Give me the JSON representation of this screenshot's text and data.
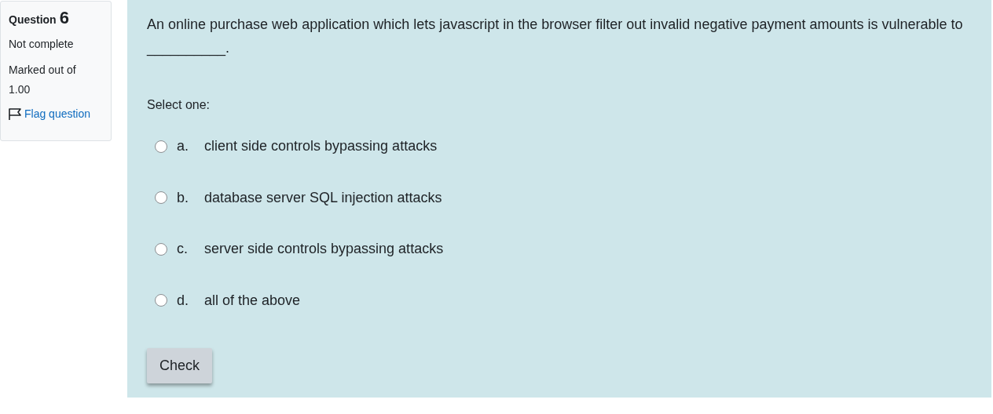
{
  "info": {
    "label": "Question",
    "number": "6",
    "status": "Not complete",
    "mark": "Marked out of 1.00",
    "flag": {
      "label": "Flag question",
      "flagged": false
    }
  },
  "question": {
    "text": "An online purchase web application which lets javascript in the browser filter out invalid negative payment amounts is vulnerable to __________.",
    "prompt": "Select one:",
    "options": [
      {
        "letter": "a.",
        "text": "client side controls bypassing attacks",
        "selected": false
      },
      {
        "letter": "b.",
        "text": "database server SQL injection attacks",
        "selected": false
      },
      {
        "letter": "c.",
        "text": "server side controls bypassing attacks",
        "selected": false
      },
      {
        "letter": "d.",
        "text": "all of the above",
        "selected": false
      }
    ]
  },
  "check_button": "Check"
}
